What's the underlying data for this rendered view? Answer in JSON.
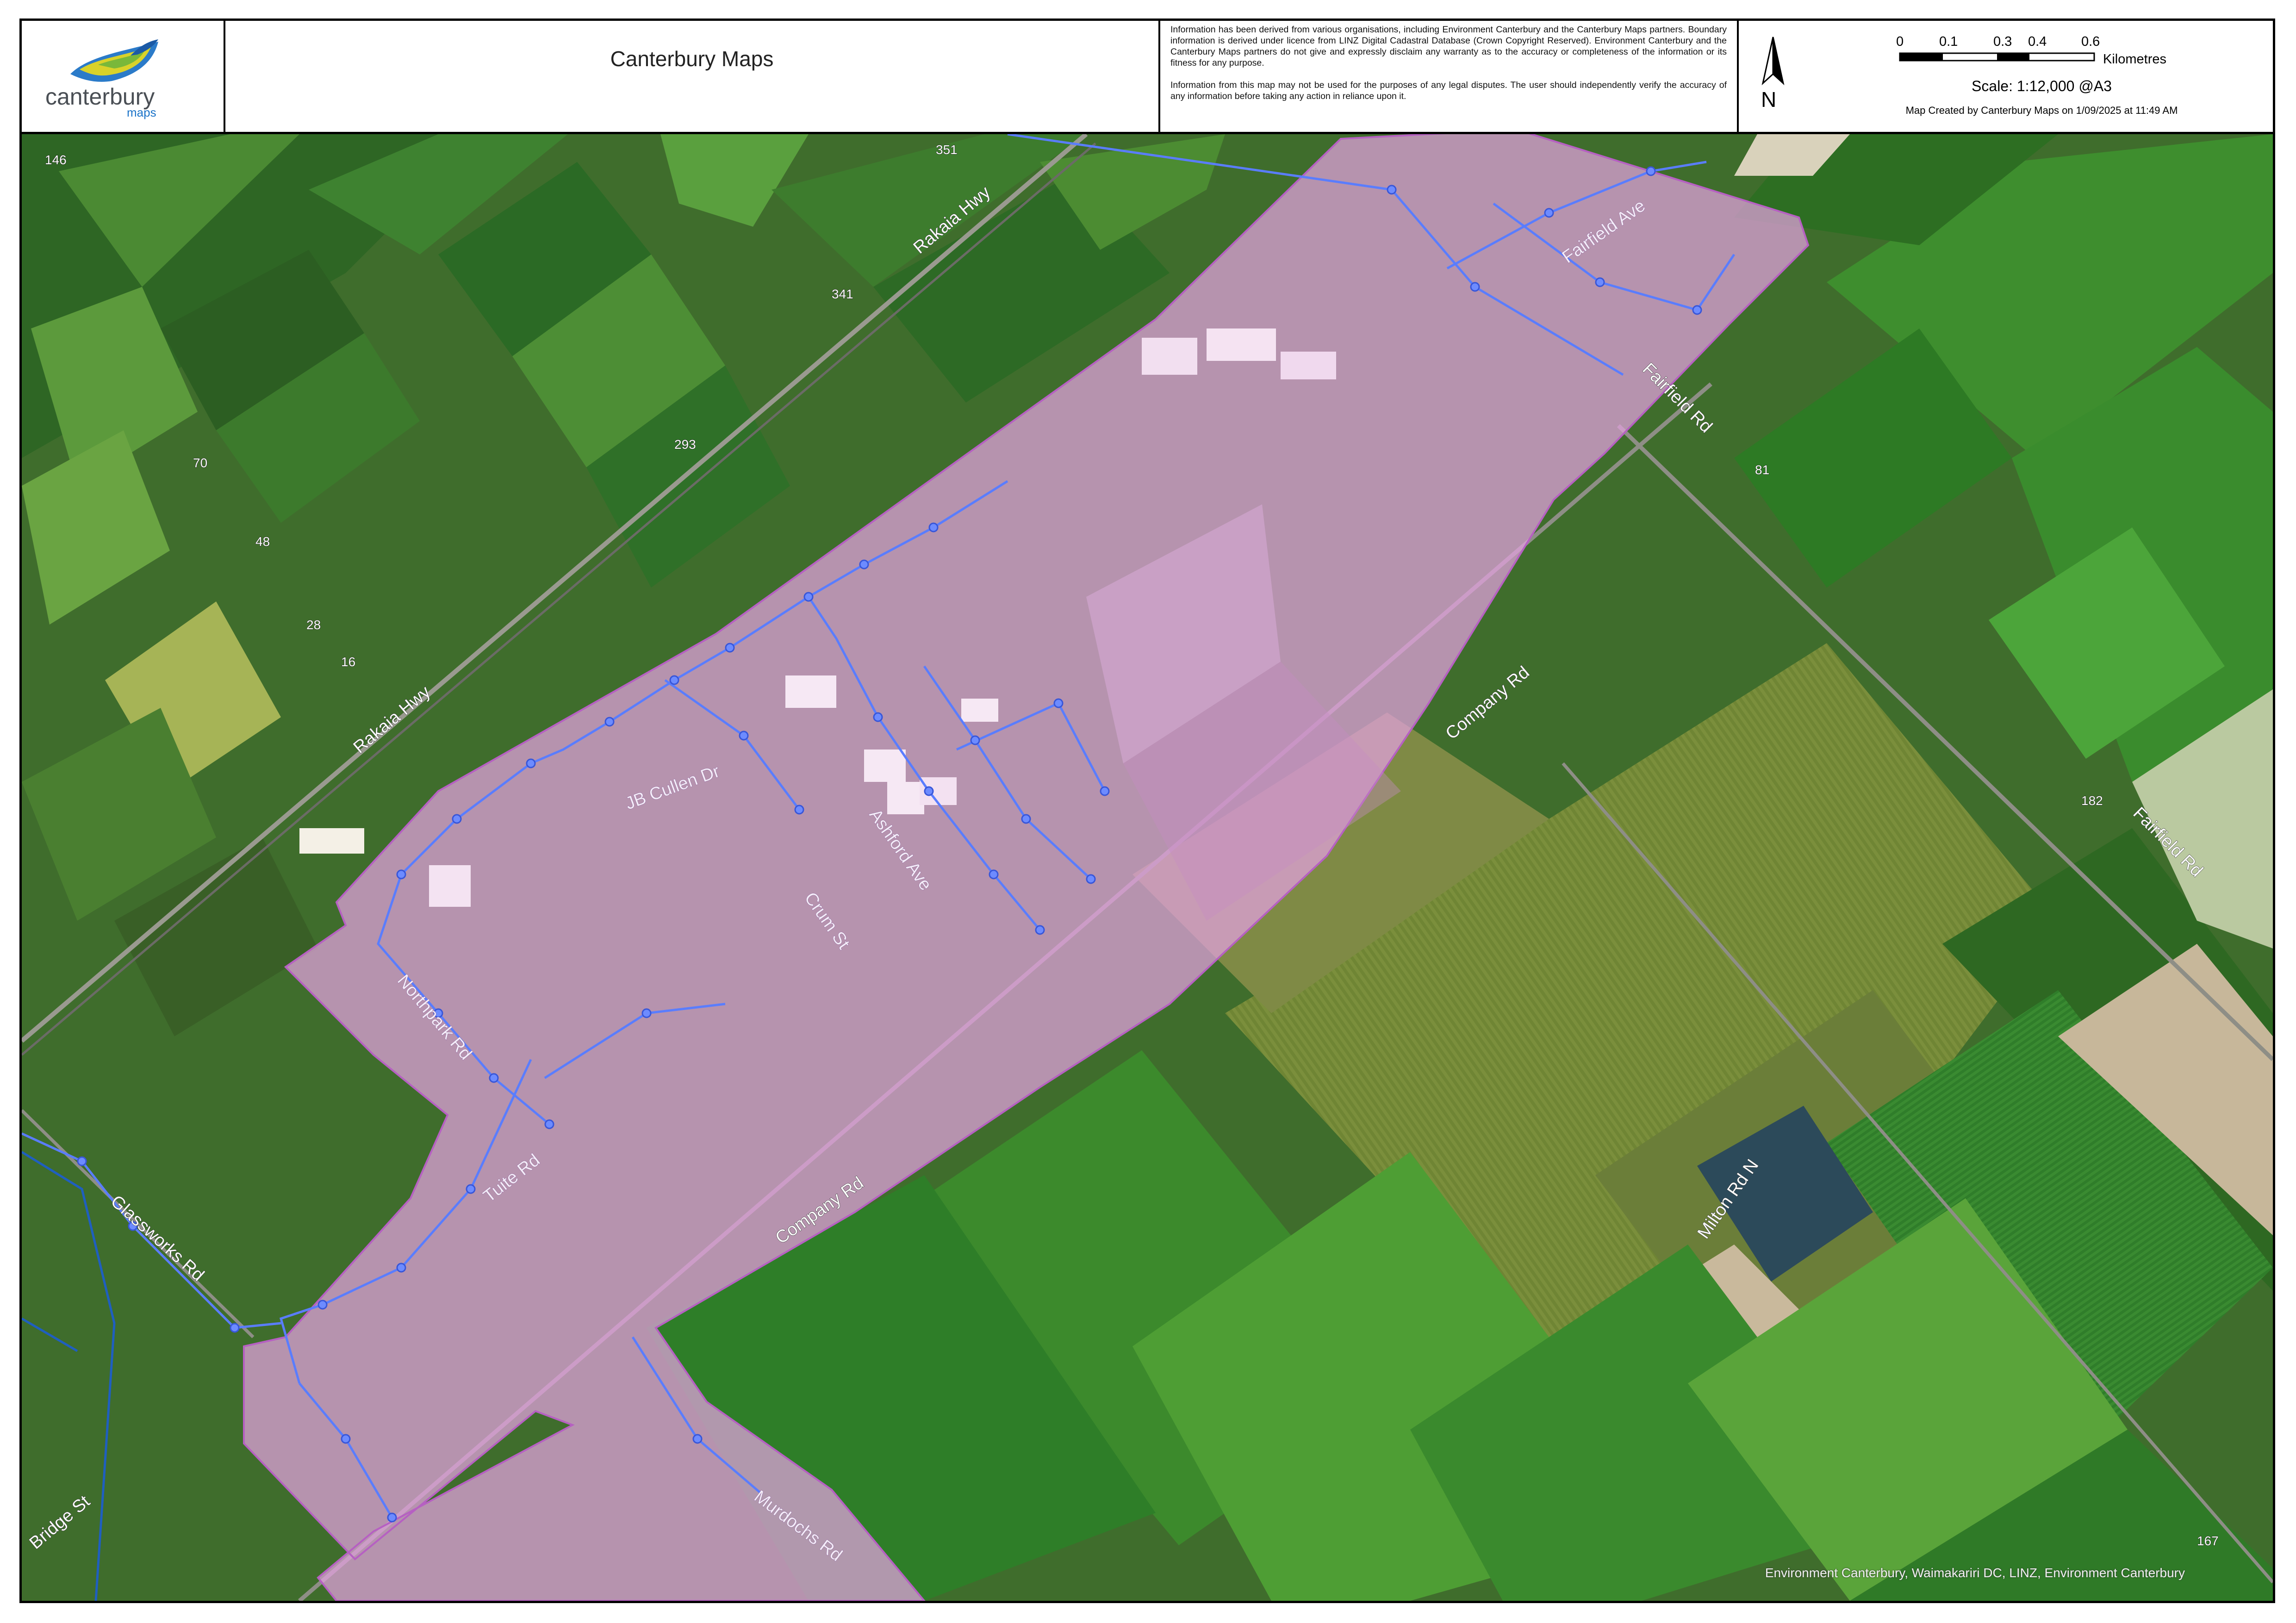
{
  "header": {
    "title": "Canterbury Maps",
    "logo": {
      "word": "canterbury",
      "sub": "maps"
    },
    "disclaimer": [
      "Information has been derived from various organisations, including Environment Canterbury and the Canterbury Maps partners. Boundary information is derived under licence from LINZ Digital Cadastral Database (Crown Copyright Reserved). Environment Canterbury and the Canterbury Maps partners do not give and expressly disclaim any warranty as to the accuracy or completeness of the information or its fitness for any purpose.",
      "Information from this map may not be used for the purposes of any legal disputes. The user should independently verify the accuracy of any information before taking any action in reliance upon it."
    ],
    "north_label": "N",
    "scalebar": {
      "ticks": [
        "0",
        "0.1",
        "0.3",
        "0.4",
        "0.6"
      ],
      "unit": "Kilometres",
      "scale_text": "Scale: 1:12,000 @A3"
    },
    "created": "Map Created by Canterbury Maps on 1/09/2025 at 11:49 AM"
  },
  "map": {
    "roads": {
      "rakaia_hwy_1": "Rakaia Hwy",
      "rakaia_hwy_2": "Rakaia Hwy",
      "jb_cullen": "JB Cullen Dr",
      "ashford": "Ashford Ave",
      "crum": "Crum St",
      "fairfield_ave": "Fairfield Ave",
      "fairfield_rd_1": "Fairfield Rd",
      "fairfield_rd_2": "Fairfield Rd",
      "company_rd_1": "Company Rd",
      "company_rd_2": "Company Rd",
      "milton": "Milton Rd N",
      "glassworks": "Glassworks Rd",
      "bridge": "Bridge St",
      "murdochs": "Murdochs Rd",
      "northpark": "Northpark Rd",
      "tuite": "Tuite Rd"
    },
    "numbers": [
      "146",
      "351",
      "341",
      "293",
      "70",
      "48",
      "28",
      "16",
      "81",
      "182",
      "167"
    ],
    "attribution": "Environment Canterbury, Waimakariri DC, LINZ, Environment Canterbury",
    "colors": {
      "overlay": "#e7a6e0",
      "overlay_stroke": "#b05abf",
      "network": "#5a7dff",
      "field_dark": "#2f6b22",
      "field_light": "#6ea23a"
    },
    "icons": [
      "north-arrow-icon",
      "canterbury-logo-icon"
    ]
  }
}
